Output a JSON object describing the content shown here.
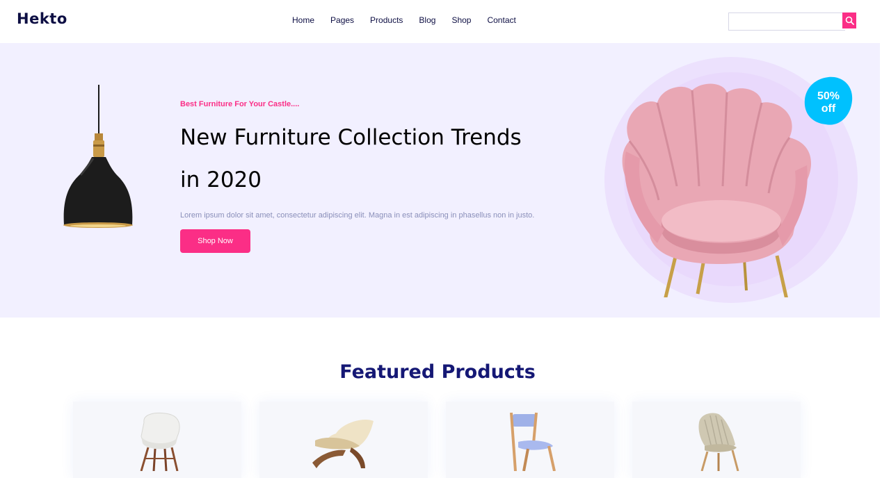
{
  "header": {
    "logo": "Hekto",
    "nav": [
      "Home",
      "Pages",
      "Products",
      "Blog",
      "Shop",
      "Contact"
    ],
    "search": {
      "value": "",
      "placeholder": ""
    }
  },
  "hero": {
    "kicker": "Best Furniture For Your Castle....",
    "title": "New Furniture Collection Trends in 2020",
    "description": "Lorem ipsum dolor sit amet, consectetur adipiscing elit. Magna in est adipiscing in phasellus non in justo.",
    "button": "Shop Now",
    "badge_line1": "50%",
    "badge_line2": "off"
  },
  "featured": {
    "title": "Featured Products"
  },
  "colors": {
    "accent": "#fb2e86",
    "brand": "#0d0e43",
    "hero_bg": "#f2f0ff",
    "badge": "#00c1fe",
    "featured_title": "#151875"
  }
}
